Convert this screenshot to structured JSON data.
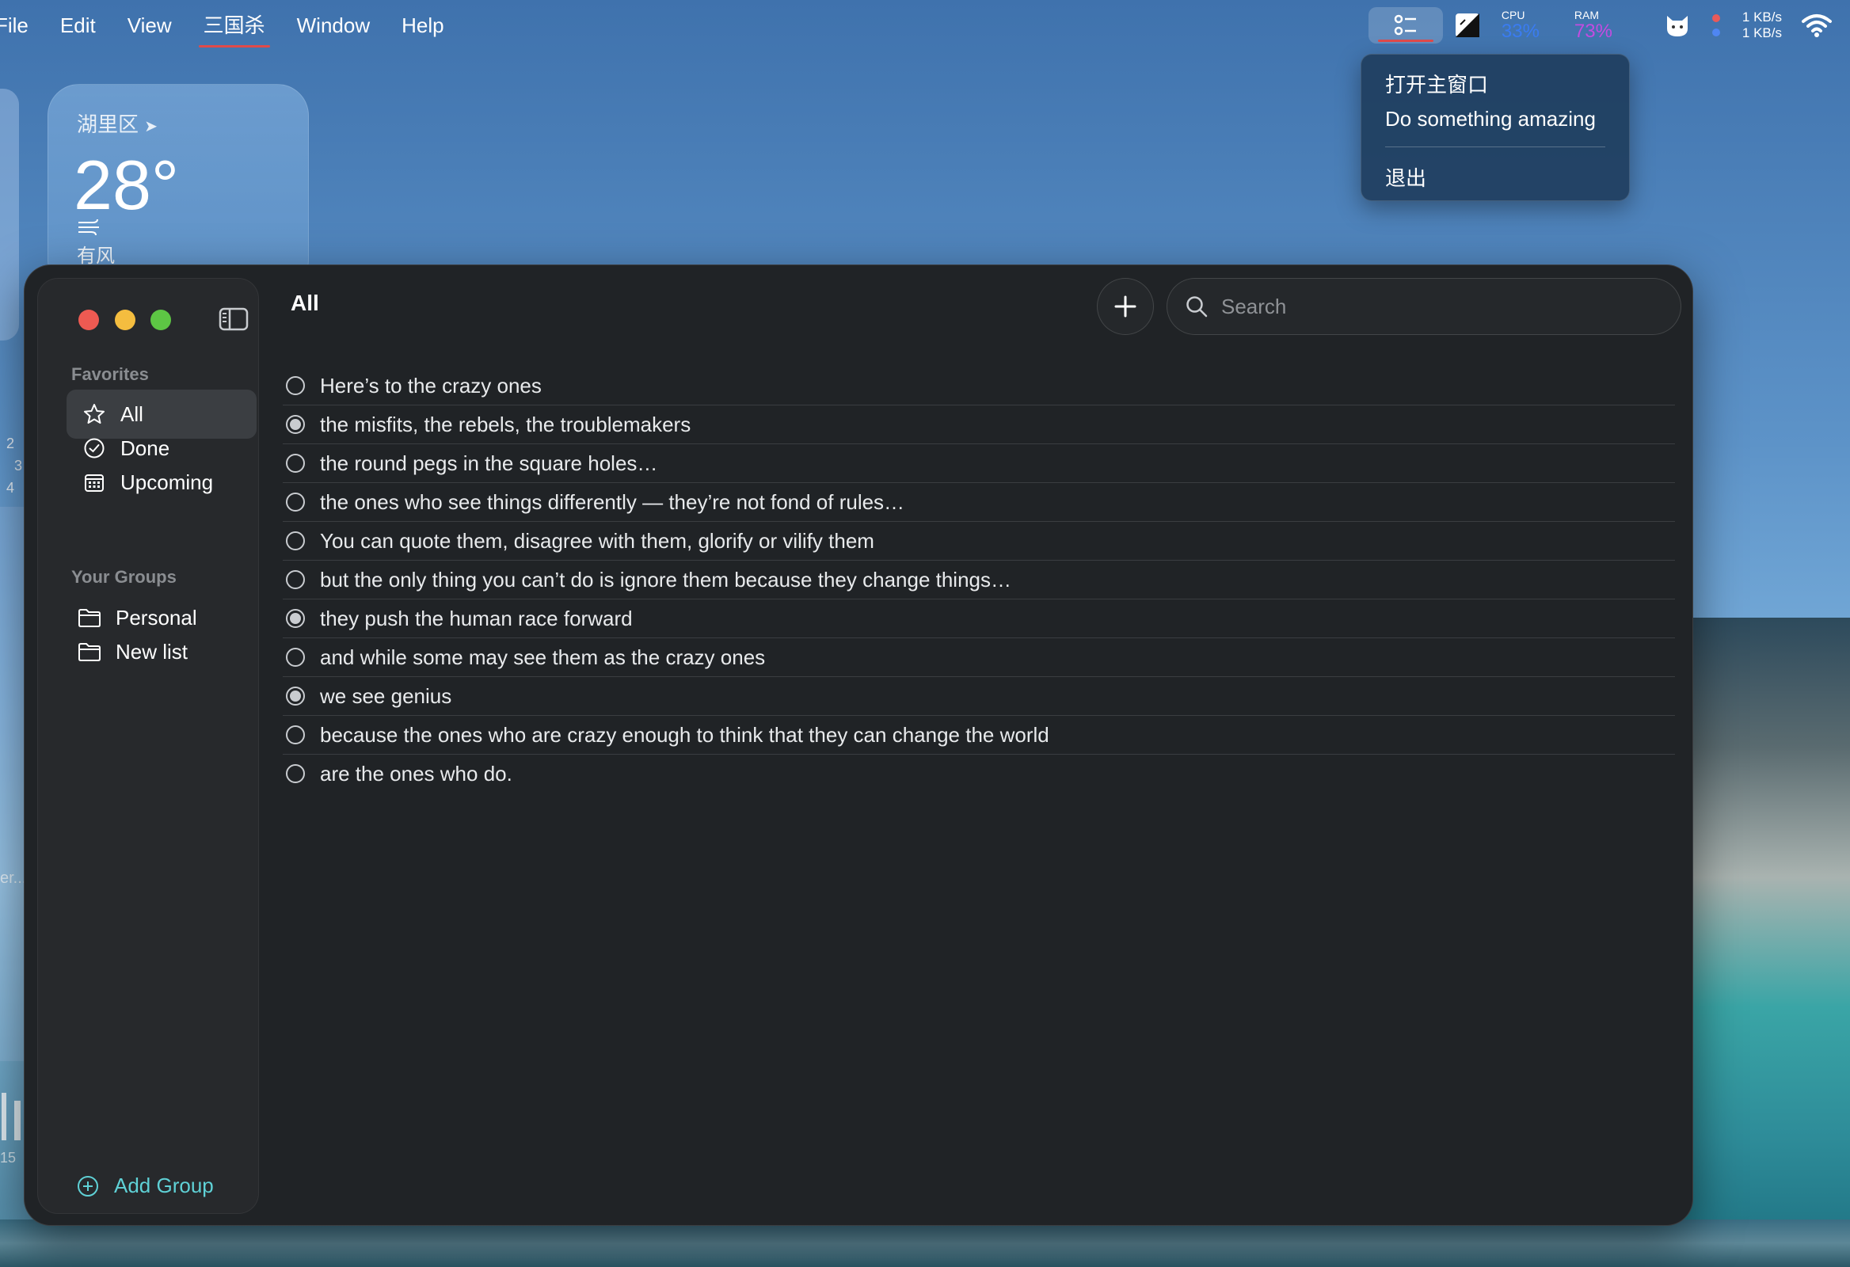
{
  "menubar": {
    "items": [
      "File",
      "Edit",
      "View",
      "三国杀",
      "Window",
      "Help"
    ],
    "active_item": "三国杀"
  },
  "status": {
    "cpu_label": "CPU",
    "cpu_value": "33%",
    "cpu_color": "#3a7cf2",
    "ram_label": "RAM",
    "ram_value": "73%",
    "ram_color": "#c34ce0",
    "net_up": "1 KB/s",
    "net_down": "1 KB/s"
  },
  "tray_menu": {
    "items": [
      "打开主窗口",
      "Do something amazing",
      "退出"
    ]
  },
  "weather": {
    "location": "湖里区",
    "temperature": "28°",
    "condition": "有风"
  },
  "desktop_partial": {
    "calendar_numbers": [
      "2",
      "3",
      "4"
    ],
    "text_fragment": "er...",
    "number_fragment": "15"
  },
  "sidebar": {
    "favorites_title": "Favorites",
    "favorites": [
      {
        "label": "All",
        "icon": "star-icon",
        "selected": true
      },
      {
        "label": "Done",
        "icon": "checkmark-circle-icon",
        "selected": false
      },
      {
        "label": "Upcoming",
        "icon": "calendar-icon",
        "selected": false
      }
    ],
    "groups_title": "Your Groups",
    "groups": [
      {
        "label": "Personal",
        "icon": "folder-icon"
      },
      {
        "label": "New list",
        "icon": "folder-icon"
      }
    ],
    "add_group_label": "Add Group",
    "accent_color": "#5fd1d6"
  },
  "main": {
    "title": "All",
    "search_placeholder": "Search",
    "tasks": [
      {
        "text": "Here’s to the crazy ones",
        "done": false
      },
      {
        "text": "the misfits, the rebels, the troublemakers",
        "done": true
      },
      {
        "text": "the round pegs in the square holes…",
        "done": false
      },
      {
        "text": "the ones who see things differently — they’re not fond of rules…",
        "done": false
      },
      {
        "text": "You can quote them, disagree with them, glorify or vilify them",
        "done": false
      },
      {
        "text": "but the only thing you can’t do is ignore them because they change things…",
        "done": false
      },
      {
        "text": "they push the human race forward",
        "done": true
      },
      {
        "text": "and while some may see them as the crazy ones",
        "done": false
      },
      {
        "text": "we see genius",
        "done": true
      },
      {
        "text": "because the ones who are crazy enough to think that they can change the world",
        "done": false
      },
      {
        "text": "are the ones who do.",
        "done": false
      }
    ]
  }
}
